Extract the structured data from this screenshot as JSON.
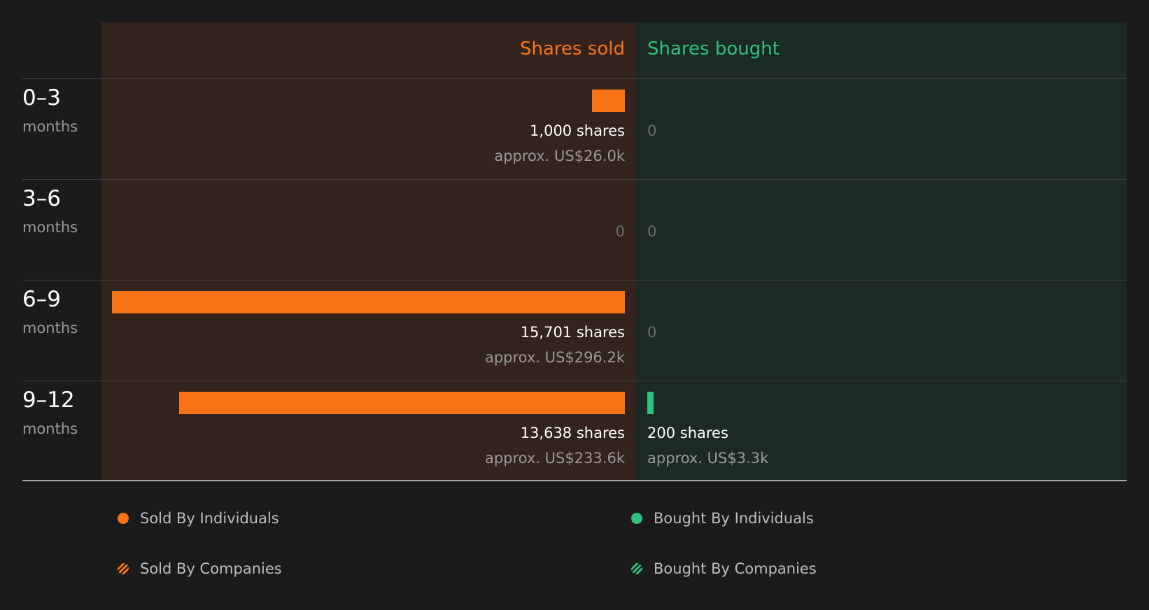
{
  "chart_data": {
    "type": "bar",
    "columns": {
      "sold": "Shares sold",
      "bought": "Shares bought"
    },
    "categories": [
      {
        "period": "0–3",
        "unit": "months"
      },
      {
        "period": "3–6",
        "unit": "months"
      },
      {
        "period": "6–9",
        "unit": "months"
      },
      {
        "period": "9–12",
        "unit": "months"
      }
    ],
    "series": [
      {
        "name": "Sold By Individuals",
        "values": [
          1000,
          0,
          15701,
          13638
        ],
        "labels": [
          "1,000 shares",
          "0",
          "15,701 shares",
          "13,638 shares"
        ],
        "approx": [
          "approx. US$26.0k",
          "",
          "approx. US$296.2k",
          "approx. US$233.6k"
        ]
      },
      {
        "name": "Bought By Individuals",
        "values": [
          0,
          0,
          0,
          200
        ],
        "labels": [
          "0",
          "0",
          "0",
          "200 shares"
        ],
        "approx": [
          "",
          "",
          "",
          "approx. US$3.3k"
        ]
      }
    ],
    "legend": [
      {
        "label": "Sold By Individuals",
        "color": "#f97316",
        "style": "solid"
      },
      {
        "label": "Bought By Individuals",
        "color": "#2ec27e",
        "style": "solid"
      },
      {
        "label": "Sold By Companies",
        "color": "#f97316",
        "style": "hatched"
      },
      {
        "label": "Bought By Companies",
        "color": "#2ec27e",
        "style": "hatched"
      }
    ],
    "legend_position": "bottom",
    "colors": {
      "sold": "#f97316",
      "bought": "#2ec27e",
      "sold_bg": "#32231c",
      "bought_bg": "#1b2a24"
    }
  }
}
